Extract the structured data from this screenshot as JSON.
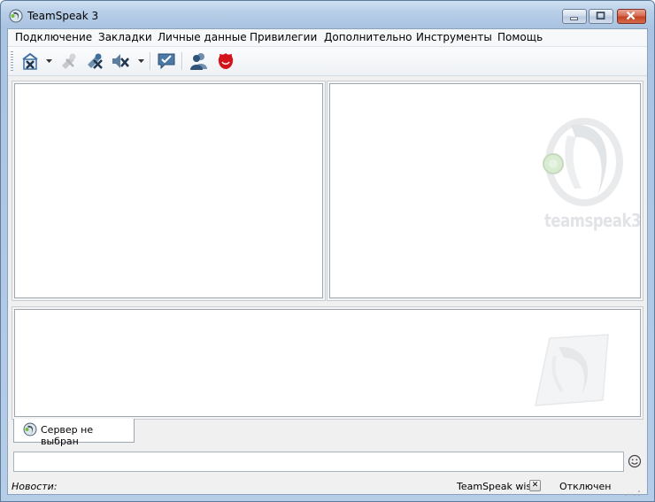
{
  "window": {
    "title": "TeamSpeak 3",
    "icons": {
      "app": "teamspeak-logo-icon",
      "minimize": "minimize-icon",
      "maximize": "maximize-icon",
      "close": "close-icon"
    }
  },
  "menu": {
    "items": [
      "Подключение",
      "Закладки",
      "Личные данные",
      "Привилегии",
      "Дополнительно",
      "Инструменты",
      "Помощь"
    ]
  },
  "toolbar": {
    "buttons": [
      {
        "icon": "disconnect-icon",
        "has_dropdown": true
      },
      {
        "icon": "mute-microphone-icon",
        "disabled": true
      },
      {
        "icon": "mute-headset-icon"
      },
      {
        "icon": "mute-speakers-icon",
        "has_dropdown": true
      },
      {
        "icon": "away-status-icon"
      },
      {
        "icon": "contacts-icon"
      },
      {
        "icon": "ts-red-sign-icon"
      }
    ]
  },
  "watermark": {
    "text": "teamspeak3"
  },
  "tabs": [
    {
      "label": "Сервер не выбран",
      "icon": "teamspeak-logo-icon"
    }
  ],
  "chat": {
    "input_value": "",
    "emoji_icon": "smiley-icon"
  },
  "status": {
    "news_label": "Новости:",
    "notification": "TeamSpeak wis",
    "close_label": "✕",
    "connection": "Отключен"
  },
  "colors": {
    "accent_red": "#d4141b",
    "icon_blue": "#3f6fa0",
    "icon_green": "#7ed23c"
  }
}
